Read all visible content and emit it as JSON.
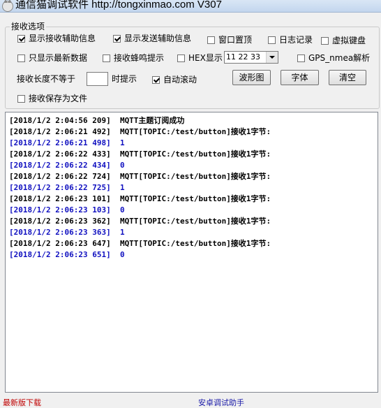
{
  "window": {
    "title": "通信猫调试软件 http://tongxinmao.com  V307"
  },
  "group": {
    "title": "接收选项"
  },
  "options": {
    "show_recv_info": {
      "label": "显示接收辅助信息",
      "checked": true
    },
    "show_send_info": {
      "label": "显示发送辅助信息",
      "checked": true
    },
    "window_top": {
      "label": "窗口置顶",
      "checked": false
    },
    "log_record": {
      "label": "日志记录",
      "checked": false
    },
    "virtual_keyboard": {
      "label": "虚拟键盘",
      "checked": false
    },
    "latest_only": {
      "label": "只显示最新数据",
      "checked": false
    },
    "beep": {
      "label": "接收蜂鸣提示",
      "checked": false
    },
    "hex_display": {
      "label": "HEX显示",
      "checked": false
    },
    "hex_value": "11 22 33",
    "gps_parse": {
      "label": "GPS_nmea解析",
      "checked": false
    },
    "length_prefix": "接收长度不等于",
    "length_value": "",
    "length_suffix": "时提示",
    "auto_scroll": {
      "label": "自动滚动",
      "checked": true
    },
    "save_file": {
      "label": "接收保存为文件",
      "checked": false
    }
  },
  "buttons": {
    "waveform": "波形图",
    "font": "字体",
    "clear": "清空"
  },
  "log": [
    {
      "text": "[2018/1/2 2:04:56 209]  MQTT主题订阅成功",
      "kind": "recv"
    },
    {
      "text": "[2018/1/2 2:06:21 492]  MQTT[TOPIC:/test/button]接收1字节:",
      "kind": "recv"
    },
    {
      "text": "[2018/1/2 2:06:21 498]  1",
      "kind": "data"
    },
    {
      "text": "[2018/1/2 2:06:22 433]  MQTT[TOPIC:/test/button]接收1字节:",
      "kind": "recv"
    },
    {
      "text": "[2018/1/2 2:06:22 434]  0",
      "kind": "data"
    },
    {
      "text": "[2018/1/2 2:06:22 724]  MQTT[TOPIC:/test/button]接收1字节:",
      "kind": "recv"
    },
    {
      "text": "[2018/1/2 2:06:22 725]  1",
      "kind": "data"
    },
    {
      "text": "[2018/1/2 2:06:23 101]  MQTT[TOPIC:/test/button]接收1字节:",
      "kind": "recv"
    },
    {
      "text": "[2018/1/2 2:06:23 103]  0",
      "kind": "data"
    },
    {
      "text": "[2018/1/2 2:06:23 362]  MQTT[TOPIC:/test/button]接收1字节:",
      "kind": "recv"
    },
    {
      "text": "[2018/1/2 2:06:23 363]  1",
      "kind": "data"
    },
    {
      "text": "[2018/1/2 2:06:23 647]  MQTT[TOPIC:/test/button]接收1字节:",
      "kind": "recv"
    },
    {
      "text": "[2018/1/2 2:06:23 651]  0",
      "kind": "data"
    }
  ],
  "status": {
    "left": "最新版下载",
    "right": "安卓调试助手"
  }
}
